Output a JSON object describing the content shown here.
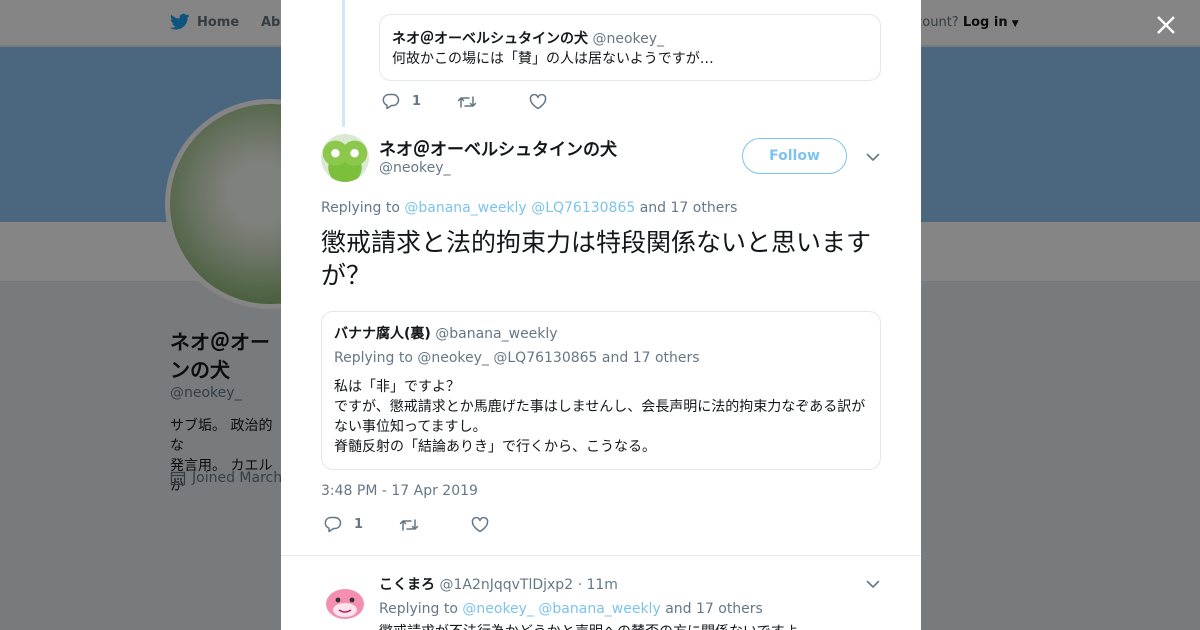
{
  "topnav": {
    "home": "Home",
    "about": "Abo",
    "login_prompt": "account?",
    "login": "Log in"
  },
  "profile": {
    "name": "ネオ＠オー\nンの犬",
    "handle": "@neokey_",
    "bio": "サブ垢。 政治的な\n発言用。 カエルか",
    "joined": "Joined March"
  },
  "parent_tweet": {
    "quote": {
      "name": "ネオ＠オーベルシュタインの犬",
      "handle": "@neokey_",
      "text": "何故かこの場には「賛」の人は居ないようですが…"
    },
    "reply_count": "1"
  },
  "main_tweet": {
    "name": "ネオ＠オーベルシュタインの犬",
    "handle": "@neokey_",
    "follow_label": "Follow",
    "replying_prefix": "Replying to",
    "replying_users": [
      "@banana_weekly",
      "@LQ76130865"
    ],
    "replying_suffix": "and 17 others",
    "text": "懲戒請求と法的拘束力は特段関係ないと思いますが？",
    "quote": {
      "name": "バナナ腐人(裏)",
      "handle": "@banana_weekly",
      "replying": "Replying to @neokey_ @LQ76130865 and 17 others",
      "lines": [
        "私は「非」ですよ？",
        "ですが、懲戒請求とか馬鹿げた事はしませんし、会長声明に法的拘束力なぞある訳がない事位知ってますし。",
        "脊髄反射の「結論ありき」で行くから、こうなる。"
      ]
    },
    "timestamp": "3:48 PM - 17 Apr 2019",
    "reply_count": "1"
  },
  "reply": {
    "name": "こくまろ",
    "handle": "@1A2nJqqvTlDjxp2",
    "time": "· 11m",
    "replying_prefix": "Replying to",
    "replying_users": [
      "@neokey_",
      "@banana_weekly"
    ],
    "replying_suffix": "and 17 others",
    "text": "懲戒請求が不法行為かどうかと声明への賛否の方に関係ないですよ"
  }
}
